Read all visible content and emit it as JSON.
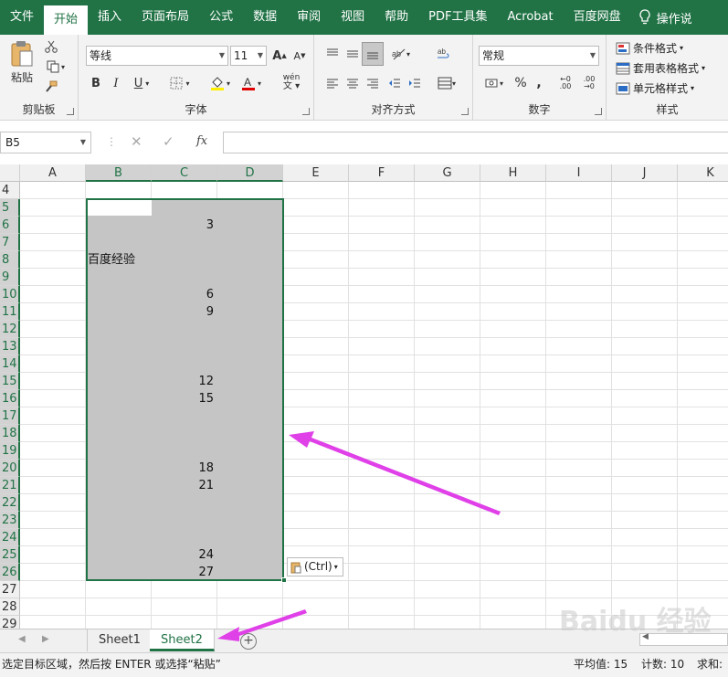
{
  "ribbon_tabs": [
    "文件",
    "开始",
    "插入",
    "页面布局",
    "公式",
    "数据",
    "审阅",
    "视图",
    "帮助",
    "PDF工具集",
    "Acrobat",
    "百度网盘"
  ],
  "tell_me": "操作说",
  "groups": {
    "clipboard": {
      "label": "剪贴板",
      "paste": "粘贴"
    },
    "font": {
      "label": "字体",
      "font_name": "等线",
      "font_size": "11",
      "bold": "B",
      "italic": "I",
      "underline": "U",
      "grow": "A",
      "shrink": "A",
      "phonetic": "wén"
    },
    "alignment": {
      "label": "对齐方式"
    },
    "number": {
      "label": "数字",
      "format": "常规",
      "percent": "%",
      "comma": ","
    },
    "styles": {
      "label": "样式",
      "conditional": "条件格式",
      "table_format": "套用表格格式",
      "cell_styles": "单元格样式"
    }
  },
  "formula_bar": {
    "name_box": "B5",
    "cancel": "✕",
    "enter": "✓",
    "fx": "fx",
    "formula": ""
  },
  "columns": [
    "A",
    "B",
    "C",
    "D",
    "E",
    "F",
    "G",
    "H",
    "I",
    "J",
    "K"
  ],
  "rows": [
    "4",
    "5",
    "6",
    "7",
    "8",
    "9",
    "10",
    "11",
    "12",
    "13",
    "14",
    "15",
    "16",
    "17",
    "18",
    "19",
    "20",
    "21",
    "22",
    "23",
    "24",
    "25",
    "26",
    "27",
    "28",
    "29"
  ],
  "cells": {
    "C6": "3",
    "B8": "百度经验",
    "C10": "6",
    "C11": "9",
    "C15": "12",
    "C16": "15",
    "C20": "18",
    "C21": "21",
    "C25": "24",
    "C26": "27"
  },
  "paste_options": "(Ctrl)",
  "sheets": [
    "Sheet1",
    "Sheet2"
  ],
  "active_sheet": "Sheet2",
  "status": {
    "message": "选定目标区域，然后按 ENTER 或选择“粘贴”",
    "average": "平均值: 15",
    "count": "计数: 10",
    "sum": "求和: "
  },
  "watermark": "Baidu 经验",
  "colors": {
    "accent": "#217346",
    "annotation_arrow": "#e040e8",
    "selection": "#c5c5c5"
  }
}
